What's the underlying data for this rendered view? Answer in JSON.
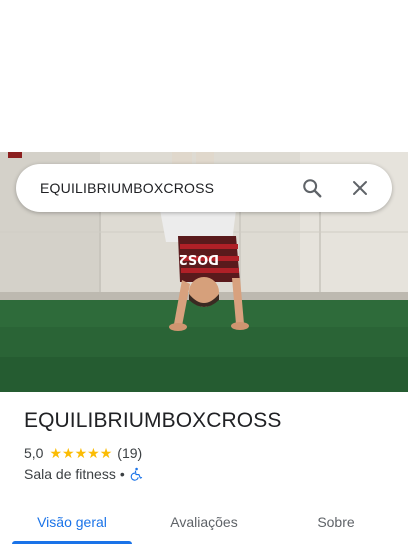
{
  "search": {
    "query": "EQUILIBRIUMBOXCROSS"
  },
  "place": {
    "name": "EQUILIBRIUMBOXCROSS",
    "rating": "5,0",
    "stars": 5,
    "reviews": "(19)",
    "category": "Sala de fitness",
    "separator": "•"
  },
  "tabs": [
    {
      "label": "Visão geral",
      "active": true
    },
    {
      "label": "Avaliações",
      "active": false
    },
    {
      "label": "Sobre",
      "active": false
    }
  ],
  "photo": {
    "shirt_text": "DOS2"
  },
  "colors": {
    "accent": "#1a73e8",
    "star": "#fbbc04",
    "turf": "#2e6b3a"
  },
  "icons": {
    "search": "search-icon",
    "close": "close-icon",
    "accessibility": "wheelchair-icon",
    "star": "star-icon"
  }
}
